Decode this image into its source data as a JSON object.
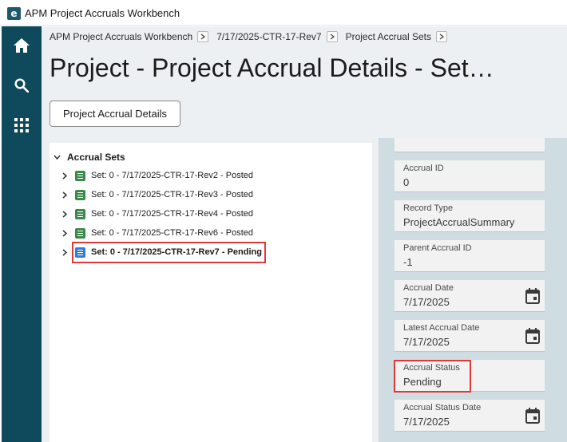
{
  "titlebar": {
    "app_title": "APM Project Accruals Workbench",
    "logo_letter": "e"
  },
  "leftnav": {
    "items": [
      "home-icon",
      "search-icon",
      "apps-grid-icon"
    ]
  },
  "breadcrumb": {
    "items": [
      "APM Project Accruals Workbench",
      "7/17/2025-CTR-17-Rev7",
      "Project Accrual Sets"
    ]
  },
  "page": {
    "title": "Project - Project Accrual Details - Set…",
    "details_button_label": "Project Accrual Details"
  },
  "tree": {
    "root_label": "Accrual Sets",
    "items": [
      {
        "label": "Set: 0 - 7/17/2025-CTR-17-Rev2 - Posted",
        "status_color": "#3b8a4c"
      },
      {
        "label": "Set: 0 - 7/17/2025-CTR-17-Rev3 - Posted",
        "status_color": "#3b8a4c"
      },
      {
        "label": "Set: 0 - 7/17/2025-CTR-17-Rev4 - Posted",
        "status_color": "#3b8a4c"
      },
      {
        "label": "Set: 0 - 7/17/2025-CTR-17-Rev6 - Posted",
        "status_color": "#3b8a4c"
      },
      {
        "label": "Set: 0 - 7/17/2025-CTR-17-Rev7 - Pending",
        "status_color": "#2e7fd8",
        "selected": true
      }
    ]
  },
  "properties": {
    "fields": [
      {
        "label": "Accrual ID",
        "value": "0"
      },
      {
        "label": "Record Type",
        "value": "ProjectAccrualSummary"
      },
      {
        "label": "Parent Accrual ID",
        "value": "-1"
      },
      {
        "label": "Accrual Date",
        "value": "7/17/2025",
        "has_calendar": true
      },
      {
        "label": "Latest Accrual Date",
        "value": "7/17/2025",
        "has_calendar": true
      },
      {
        "label": "Accrual Status",
        "value": "Pending"
      },
      {
        "label": "Accrual Status Date",
        "value": "7/17/2025",
        "has_calendar": true
      }
    ]
  },
  "colors": {
    "nav_bg": "#0e4a5b",
    "highlight": "#e0393a",
    "posted": "#3b8a4c",
    "pending": "#2e7fd8"
  }
}
